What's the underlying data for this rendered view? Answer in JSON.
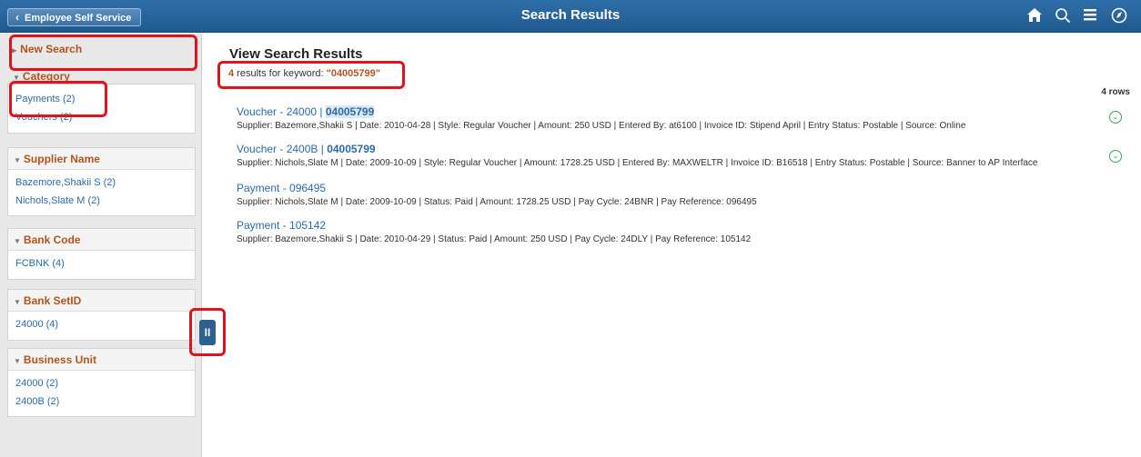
{
  "header": {
    "back_label": "Employee Self Service",
    "title": "Search Results",
    "icons": [
      "home-icon",
      "search-icon",
      "menu-icon",
      "navbar-icon"
    ]
  },
  "sidebar": {
    "new_search": "New Search",
    "category": {
      "label": "Category",
      "items": [
        "Payments (2)",
        "Vouchers (2)"
      ]
    },
    "facets": [
      {
        "label": "Supplier Name",
        "items": [
          "Bazemore,Shakii S (2)",
          "Nichols,Slate M (2)"
        ]
      },
      {
        "label": "Bank Code",
        "items": [
          "FCBNK (4)"
        ]
      },
      {
        "label": "Bank SetID",
        "items": [
          "24000 (4)"
        ]
      },
      {
        "label": "Business Unit",
        "items": [
          "24000 (2)",
          "2400B (2)"
        ]
      }
    ]
  },
  "toggle": {
    "label": "II"
  },
  "main": {
    "title": "View Search Results",
    "count": "4",
    "count_text": " results for keyword: ",
    "keyword": "\"04005799\"",
    "rows": "4 rows",
    "results": [
      {
        "title": "Voucher - 24000 | ",
        "title_bold": "04005799",
        "desc": "Supplier: Bazemore,Shakii S | Date: 2010-04-28 | Style: Regular Voucher | Amount: 250 USD | Entered By: at6100 | Invoice ID: Stipend April | Entry Status: Postable | Source: Online"
      },
      {
        "title": "Voucher - 2400B | ",
        "title_bold": "04005799",
        "desc": "Supplier: Nichols,Slate M | Date: 2009-10-09 | Style: Regular Voucher | Amount: 1728.25 USD | Entered By: MAXWELTR | Invoice ID: B16518 | Entry Status: Postable | Source: Banner to AP Interface"
      },
      {
        "title": "Payment - 096495",
        "title_bold": "",
        "desc": "Supplier: Nichols,Slate M | Date: 2009-10-09 | Status: Paid | Amount: 1728.25 USD | Pay Cycle: 24BNR | Pay Reference: 096495"
      },
      {
        "title": "Payment - 105142",
        "title_bold": "",
        "desc": "Supplier: Bazemore,Shakii S | Date: 2010-04-29 | Status: Paid | Amount: 250 USD | Pay Cycle: 24DLY | Pay Reference: 105142"
      }
    ]
  },
  "colors": {
    "header_bg": "#2f6fa7",
    "facet_label": "#b3531e",
    "link": "#2c6aa8",
    "annotation": "#e0131b"
  }
}
